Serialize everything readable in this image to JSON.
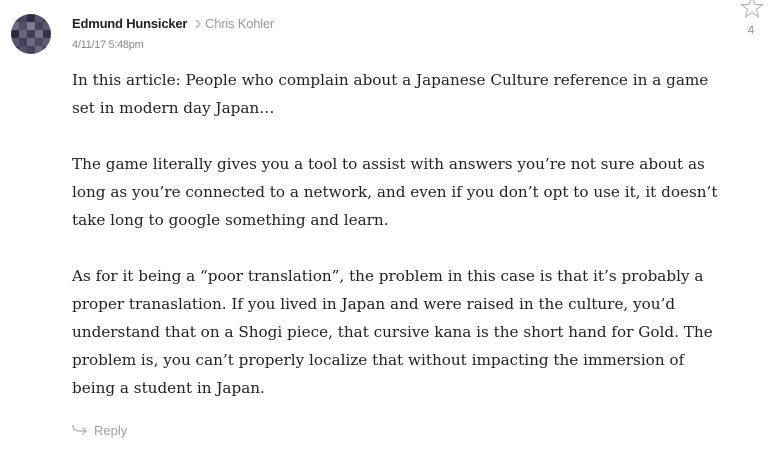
{
  "comment": {
    "author": "Edmund Hunsicker",
    "in_reply_to": "Chris Kohler",
    "timestamp": "4/11/17 5:48pm",
    "star_count": "4",
    "paragraphs": [
      "In this article: People who complain about a Japanese Culture reference in a game set in modern day Japan…",
      "The game literally gives you a tool to assist with answers you’re not sure about as long as you’re connected to a network, and even if you don’t opt to use it, it doesn’t take long to google something and learn.",
      "As for it being a “poor translation”, the problem in this case is that it’s probably a proper tranaslation. If you lived in Japan and were raised in the culture, you’d understand that on a Shogi piece, that cursive kana is the short hand for Gold. The problem is, you can’t properly localize that without impacting the immersion of being a student in Japan."
    ],
    "reply_label": "Reply"
  },
  "icons": {
    "avatar": "pixelated-avatar",
    "reply_to_separator": "chevron-right-icon",
    "star": "star-outline-icon",
    "reply": "reply-arrow-icon"
  },
  "colors": {
    "author": "#222222",
    "meta": "#999999",
    "body_text": "#222222",
    "reply": "#a0a0a0"
  }
}
